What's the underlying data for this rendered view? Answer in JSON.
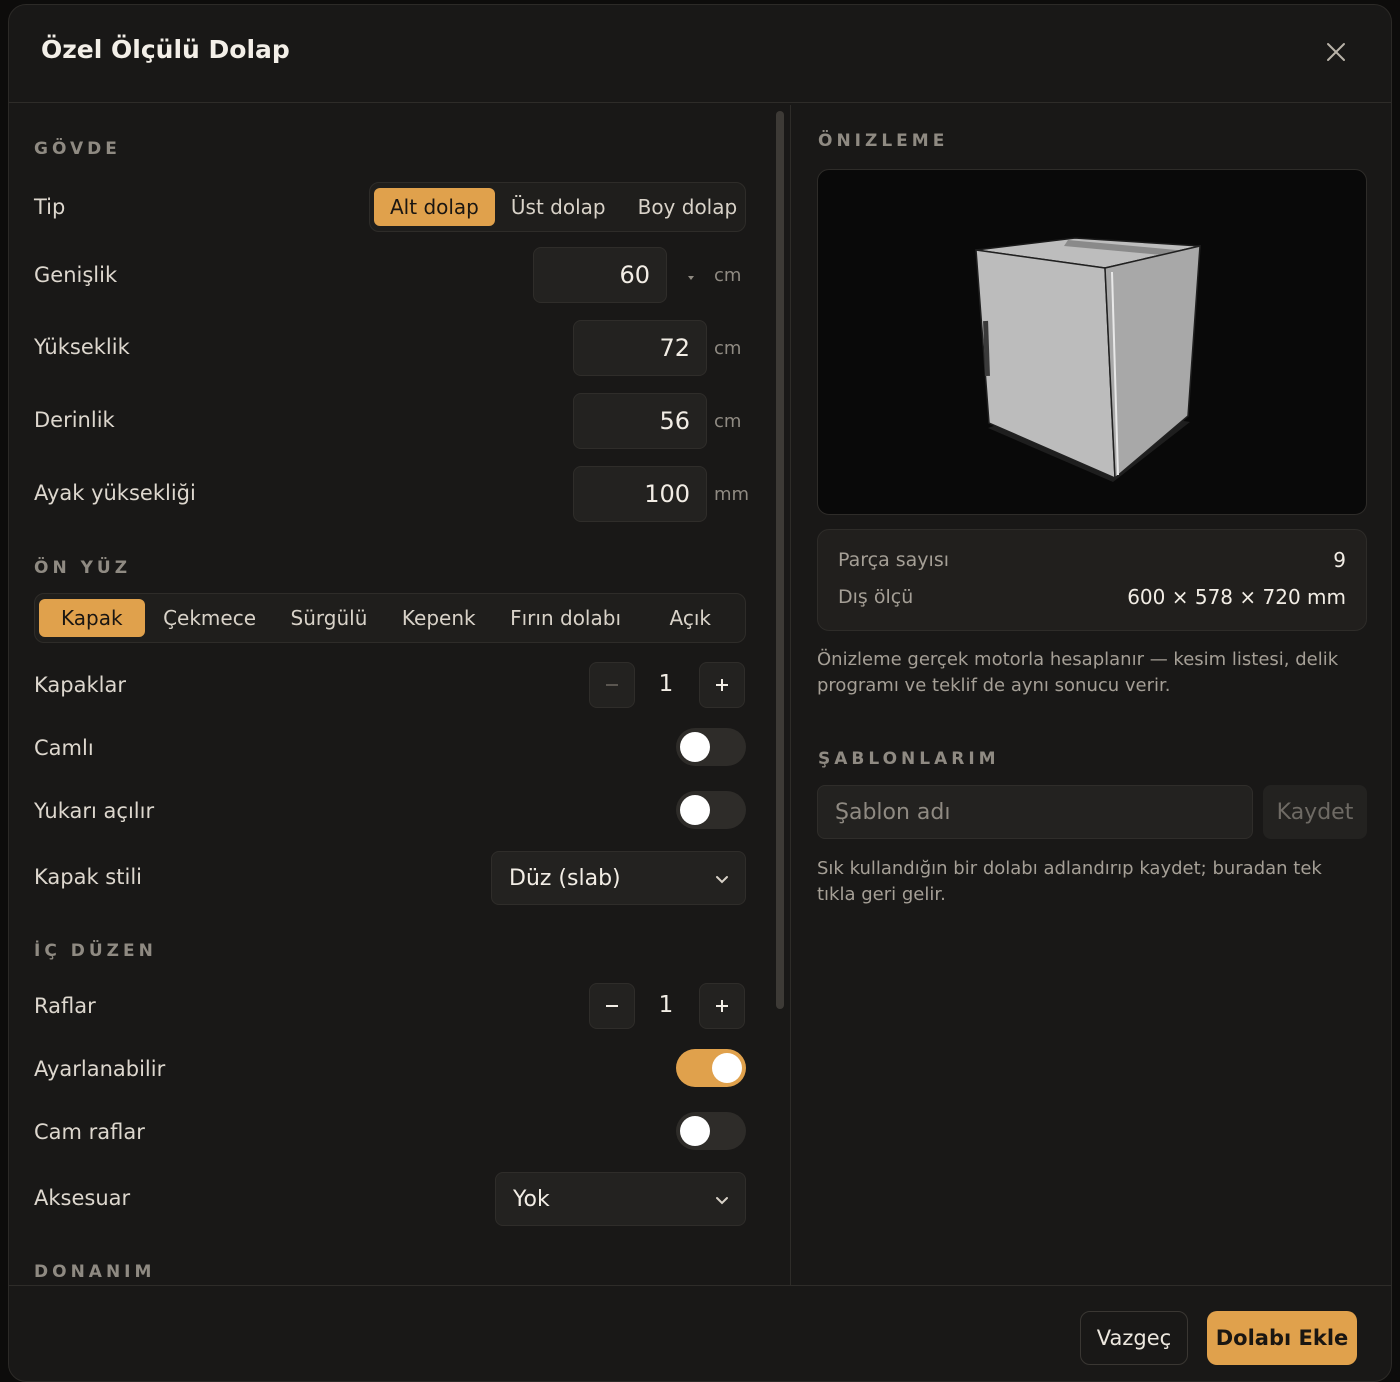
{
  "modal": {
    "title": "Özel Ölçülü Dolap"
  },
  "body_section": {
    "title": "GÖVDE",
    "type_label": "Tip",
    "type_options": [
      "Alt dolap",
      "Üst dolap",
      "Boy dolap"
    ],
    "type_selected": "Alt dolap",
    "width": {
      "label": "Genişlik",
      "value": "60",
      "unit": "cm"
    },
    "height": {
      "label": "Yükseklik",
      "value": "72",
      "unit": "cm"
    },
    "depth": {
      "label": "Derinlik",
      "value": "56",
      "unit": "cm"
    },
    "leg_height": {
      "label": "Ayak yüksekliği",
      "value": "100",
      "unit": "mm"
    }
  },
  "front_section": {
    "title": "ÖN YÜZ",
    "options": [
      "Kapak",
      "Çekmece",
      "Sürgülü",
      "Kepenk",
      "Fırın dolabı",
      "Açık"
    ],
    "selected": "Kapak",
    "doors": {
      "label": "Kapaklar",
      "value": "1"
    },
    "glass": {
      "label": "Camlı",
      "on": false
    },
    "lift_up": {
      "label": "Yukarı açılır",
      "on": false
    },
    "door_style": {
      "label": "Kapak stili",
      "value": "Düz (slab)"
    }
  },
  "interior_section": {
    "title": "İÇ DÜZEN",
    "shelves": {
      "label": "Raflar",
      "value": "1"
    },
    "adjustable": {
      "label": "Ayarlanabilir",
      "on": true
    },
    "glass_shelves": {
      "label": "Cam raflar",
      "on": false
    },
    "accessory": {
      "label": "Aksesuar",
      "value": "Yok"
    }
  },
  "hardware_section": {
    "title": "DONANIM"
  },
  "preview": {
    "title": "ÖNIZLEME",
    "part_count_label": "Parça sayısı",
    "part_count": "9",
    "outer_dims_label": "Dış ölçü",
    "outer_dims": "600 × 578 × 720 mm",
    "note": "Önizleme gerçek motorla hesaplanır — kesim listesi, delik programı ve teklif de aynı sonucu verir."
  },
  "templates": {
    "title": "ŞABLONLARIM",
    "input_placeholder": "Şablon adı",
    "save_label": "Kaydet",
    "note": "Sık kullandığın bir dolabı adlandırıp kaydet; buradan tek tıkla geri gelir."
  },
  "footer": {
    "cancel_label": "Vazgeç",
    "add_label": "Dolabı Ekle"
  },
  "colors": {
    "accent": "#e0a14c",
    "background": "#191817",
    "panel": "#232220"
  }
}
